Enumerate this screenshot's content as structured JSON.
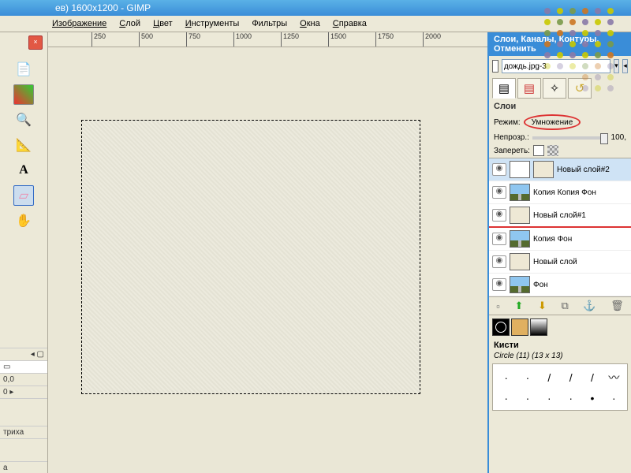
{
  "title_bar": "ев) 1600x1200 - GIMP",
  "menu": {
    "image": "Изображение",
    "layer": "Слой",
    "color": "Цвет",
    "tools": "Инструменты",
    "filters": "Фильтры",
    "windows": "Окна",
    "help": "Справка"
  },
  "ruler_ticks": [
    "250",
    "500",
    "750",
    "1000",
    "1250",
    "1500",
    "1750",
    "2000"
  ],
  "left": {
    "coord": "0,0",
    "zoom": "0",
    "label_1": "триха",
    "label_2": "а"
  },
  "panel": {
    "title": "Слои, Каналы, Контуры, Отменить",
    "doc_name": "дождь.jpg-3",
    "section": "Слои",
    "mode_label": "Режим:",
    "mode_value": "Умножение",
    "opacity_label": "Непрозр.:",
    "opacity_value": "100,",
    "lock_label": "Запереть:"
  },
  "layers": [
    {
      "name": "Новый слой#2",
      "thumb": "beige",
      "selected": true
    },
    {
      "name": "Копия Копия Фон",
      "thumb": "sky"
    },
    {
      "name": "Новый слой#1",
      "thumb": "beige",
      "underline": true
    },
    {
      "name": "Копия Фон",
      "thumb": "sky"
    },
    {
      "name": "Новый слой",
      "thumb": "beige"
    },
    {
      "name": "Фон",
      "thumb": "sky"
    }
  ],
  "brushes": {
    "title": "Кисти",
    "current": "Circle (11) (13 x 13)"
  }
}
